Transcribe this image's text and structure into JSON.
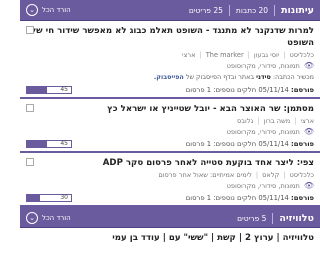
{
  "section1": {
    "title": "עיתונות",
    "articles_count": "20 כתבות",
    "items_count": "25 פריטים",
    "download_all": "הורד הכל",
    "download_icon": "chevron-down-icon"
  },
  "articles": [
    {
      "title": "למרות שדנקנר לא מתנגד - השופט תאלמ כבוג לא מאפשר שידור חי של השופט",
      "meta": [
        "כלכליסט",
        "יוסי גבעון",
        "The marker",
        "ארצי"
      ],
      "view_label": "תמונות, סידורי, מקרוסופט",
      "summary_prefix": "מכשיר הכתבה:",
      "summary_bold": "סידני",
      "summary_rest": "באתר ובדף הפייסבוק של",
      "summary_fb": "הפייסבוק.",
      "publish_label": "פורסם:",
      "publish_date": "05/11/14",
      "publish_extra": "חלקים נוספים: 1 פרסום",
      "score": 45,
      "score_label": "45"
    },
    {
      "title": "מסתמן: שר האוצר הבא - יובל שטייניץ או ישראל כץ",
      "meta": [
        "ארצי",
        "משה ברון",
        "גלובס"
      ],
      "view_label": "תמונות, סידורי, מקרוסופט",
      "publish_label": "פורסם:",
      "publish_date": "05/11/14",
      "publish_extra": "חלקים נוספים: 1 פרסום",
      "score": 45,
      "score_label": "45"
    },
    {
      "title": "צפי: ליצר אחד בוקעת סטייה לאחר פרסום סקר ADP",
      "meta": [
        "כלכליסט",
        "קלאס",
        "לימים אמיתיים: שאול אחר פרסום"
      ],
      "view_label": "תמונות, סידורי, מקרוסופט",
      "publish_label": "פורסם:",
      "publish_date": "05/11/14",
      "publish_extra": "חלקים נוספים: 1 פרסום",
      "score": 30,
      "score_label": "30"
    }
  ],
  "section2": {
    "title": "טלוויזיה",
    "items_count": "5 פריטים",
    "download_all": "הורד הכל",
    "download_icon": "chevron-down-icon"
  },
  "tv_item": {
    "title": "טלוויזיה | ערוץ 2 | קשת | \"ששי\" עם | עודד בן עמי"
  },
  "colors": {
    "accent": "#6a5a9e",
    "accent_dark": "#4f4182"
  }
}
